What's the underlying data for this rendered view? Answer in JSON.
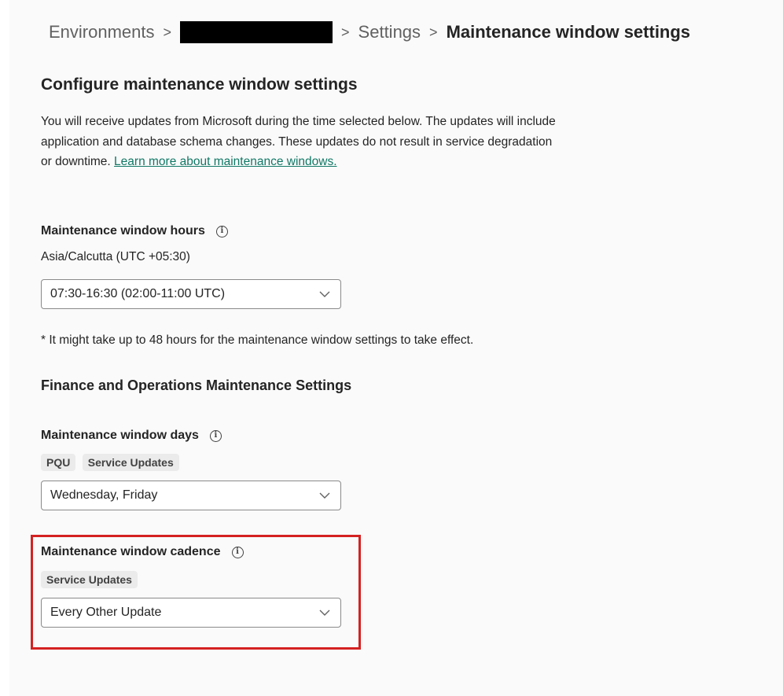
{
  "breadcrumb": {
    "item1": "Environments",
    "item2_redacted": "",
    "item3": "Settings",
    "current": "Maintenance window settings",
    "separator": ">"
  },
  "page": {
    "heading": "Configure maintenance window settings",
    "description": "You will receive updates from Microsoft during the time selected below. The updates will include application and database schema changes. These updates do not result in service degradation or downtime.",
    "learn_more_link": "Learn more about maintenance windows."
  },
  "hours": {
    "label": "Maintenance window hours",
    "timezone": "Asia/Calcutta (UTC +05:30)",
    "selected": "07:30-16:30 (02:00-11:00 UTC)"
  },
  "note": "* It might take up to 48 hours for the maintenance window settings to take effect.",
  "fo_section": {
    "heading": "Finance and Operations Maintenance Settings"
  },
  "days": {
    "label": "Maintenance window days",
    "tags": [
      "PQU",
      "Service Updates"
    ],
    "selected": "Wednesday, Friday"
  },
  "cadence": {
    "label": "Maintenance window cadence",
    "tags": [
      "Service Updates"
    ],
    "selected": "Every Other Update"
  },
  "icons": {
    "info": "info-icon",
    "chevron": "chevron-down-icon"
  },
  "colors": {
    "link": "#117865",
    "highlight_border": "#d42121",
    "background": "#fafafa"
  }
}
